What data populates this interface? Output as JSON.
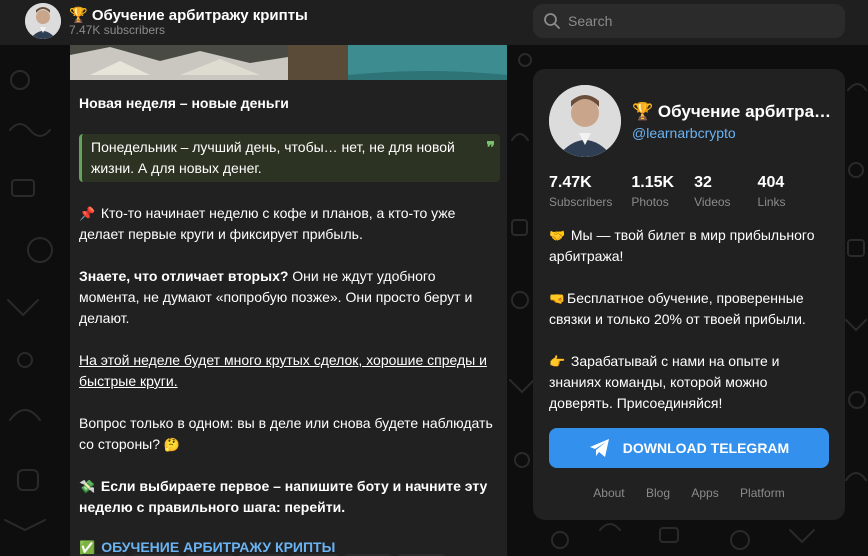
{
  "header": {
    "title": "🏆 Обучение арбитражу крипты",
    "subscribers": "7.47K subscribers",
    "search_placeholder": "Search"
  },
  "post": {
    "heading": "Новая неделя – новые деньги",
    "quote": "Понедельник – лучший день, чтобы… нет, не для новой жизни. А для новых денег.",
    "quote_mark": "❞",
    "para1_emoji": "📌",
    "para1": "Кто-то начинает неделю с кофе и планов, а кто-то уже делает первые круги и фиксирует прибыль.",
    "para2_bold": "Знаете, что отличает вторых?",
    "para2_rest": " Они не ждут удобного момента, не думают «попробую позже». Они просто берут и делают.",
    "para3": "На этой неделе будет много крутых сделок, хорошие спреды и быстрые круги.",
    "para4": "Вопрос только в одном: вы в деле или снова будете наблюдать со стороны?",
    "para4_emoji": "🤔",
    "para5_emoji": "💸",
    "para5": "Если выбираете первое – напишите боту и начните эту неделю с правильного шага: перейти.",
    "link_emoji": "✅",
    "link": "ОБУЧЕНИЕ АРБИТРАЖУ КРИПТЫ"
  },
  "card": {
    "name": "🏆 Обучение арбитражу крипты",
    "handle": "@learnarbcrypto",
    "stats": [
      {
        "value": "7.47K",
        "label": "Subscribers"
      },
      {
        "value": "1.15K",
        "label": "Photos"
      },
      {
        "value": "32",
        "label": "Videos"
      },
      {
        "value": "404",
        "label": "Links"
      }
    ],
    "desc1_emoji": "🤝",
    "desc1": "Мы — твой билет в мир прибыльного арбитража!",
    "desc2_emoji": "🤜",
    "desc2": "Бесплатное обучение, проверенные связки и только 20% от твоей прибыли.",
    "desc3_emoji": "👉",
    "desc3": "Зарабатывай с нами на опыте и знаниях команды, которой можно доверять. Присоединяйся!",
    "download_label": "DOWNLOAD TELEGRAM",
    "footer": [
      "About",
      "Blog",
      "Apps",
      "Platform"
    ]
  },
  "colors": {
    "accent": "#3390ec",
    "link": "#6ab3f3",
    "panel": "#212121",
    "background": "#0e0e0e"
  }
}
